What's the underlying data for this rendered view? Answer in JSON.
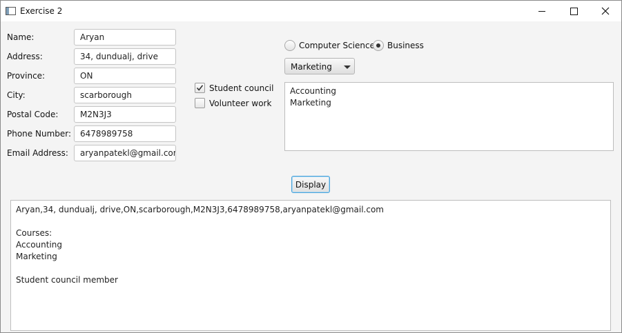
{
  "window": {
    "title": "Exercise 2"
  },
  "form": {
    "name": {
      "label": "Name:",
      "value": "Aryan"
    },
    "address": {
      "label": "Address:",
      "value": "34, dundualj, drive"
    },
    "province": {
      "label": "Province:",
      "value": "ON"
    },
    "city": {
      "label": "City:",
      "value": "scarborough"
    },
    "postal": {
      "label": "Postal Code:",
      "value": "M2N3J3"
    },
    "phone": {
      "label": "Phone Number:",
      "value": "6478989758"
    },
    "email": {
      "label": "Email Address:",
      "value": "aryanpatekl@gmail.com"
    }
  },
  "checkboxes": [
    {
      "label": "Student council",
      "checked": true
    },
    {
      "label": "Volunteer work",
      "checked": false
    }
  ],
  "radios": [
    {
      "label": "Computer Science",
      "selected": false
    },
    {
      "label": "Business",
      "selected": true
    }
  ],
  "combo": {
    "value": "Marketing"
  },
  "course_list": [
    "Accounting",
    "Marketing"
  ],
  "display_button": {
    "label": "Display"
  },
  "output": {
    "lines": [
      "Aryan,34, dundualj, drive,ON,scarborough,M2N3J3,6478989758,aryanpatekl@gmail.com",
      "",
      "Courses:",
      "Accounting",
      "Marketing",
      "",
      "Student council member"
    ]
  },
  "icons": {
    "app": "window-app-icon",
    "minimize": "minimize-icon",
    "maximize": "maximize-icon",
    "close": "close-icon",
    "check": "checkmark-icon",
    "dropdown": "chevron-down-icon"
  },
  "colors": {
    "focus_border": "#4aa3d9",
    "background": "#f4f4f4"
  }
}
